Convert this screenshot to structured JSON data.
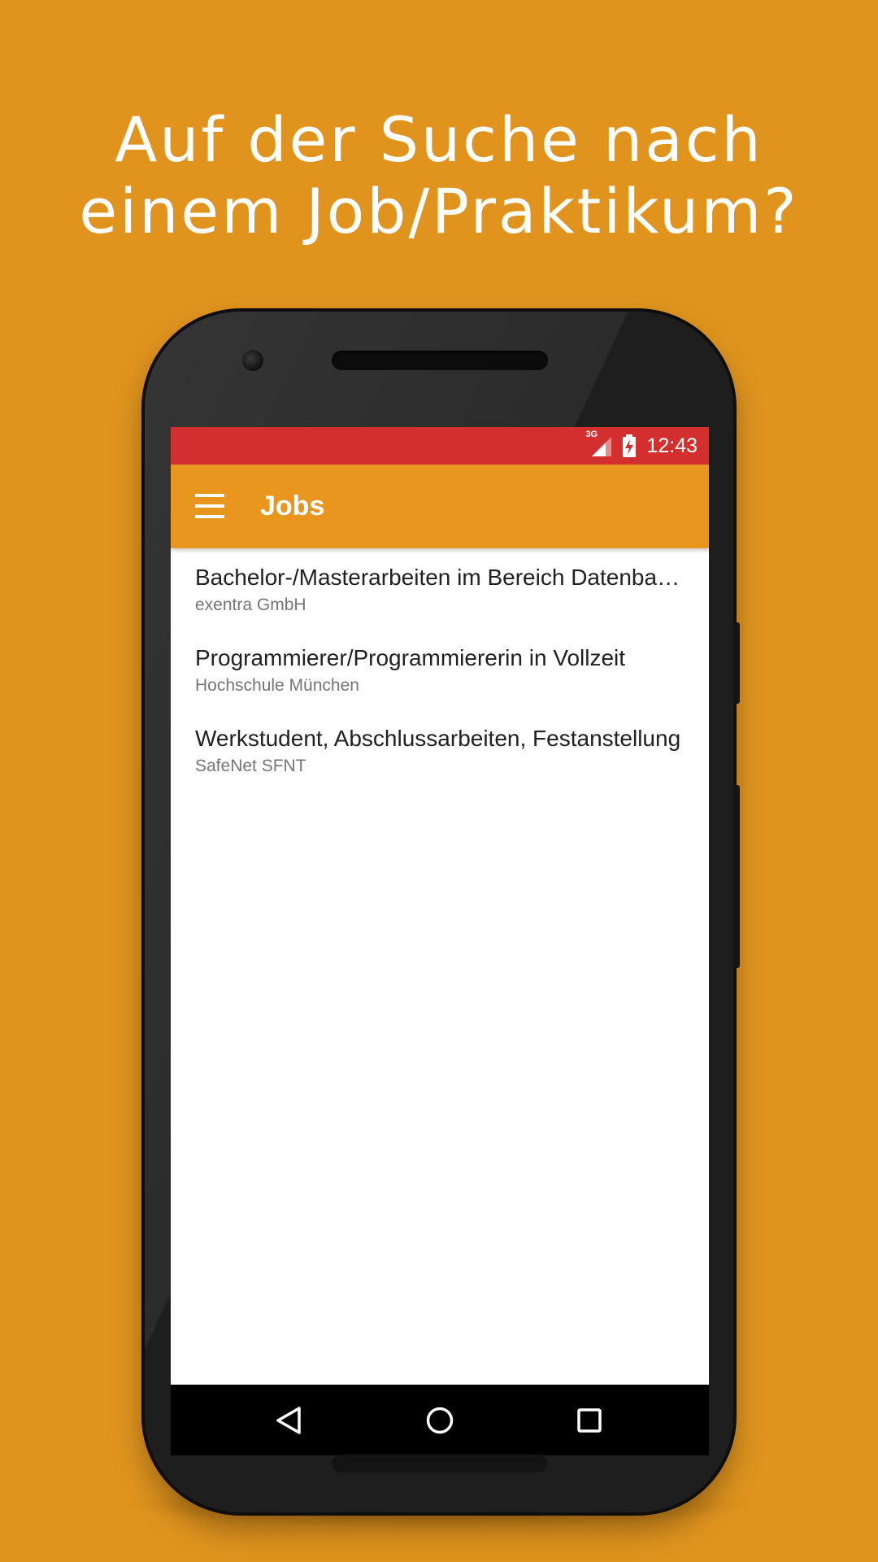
{
  "headline": {
    "line1": "Auf der Suche nach",
    "line2": "einem Job/Praktikum?"
  },
  "status_bar": {
    "network": "3G",
    "time": "12:43",
    "color": "#D32F2F"
  },
  "toolbar": {
    "title": "Jobs",
    "menu_icon": "hamburger-menu-icon",
    "color": "#E8961E"
  },
  "jobs": [
    {
      "title": "Bachelor-/Masterarbeiten im Bereich Datenbanken",
      "company": "exentra GmbH"
    },
    {
      "title": "Programmierer/Programmiererin in Vollzeit",
      "company": "Hochschule München"
    },
    {
      "title": "Werkstudent, Abschlussarbeiten, Festanstellung",
      "company": "SafeNet SFNT"
    }
  ],
  "nav_bar": {
    "buttons": [
      "back-icon",
      "home-icon",
      "recents-icon"
    ]
  },
  "colors": {
    "background": "#E0941E",
    "phone_body": "#1e1e1e"
  }
}
